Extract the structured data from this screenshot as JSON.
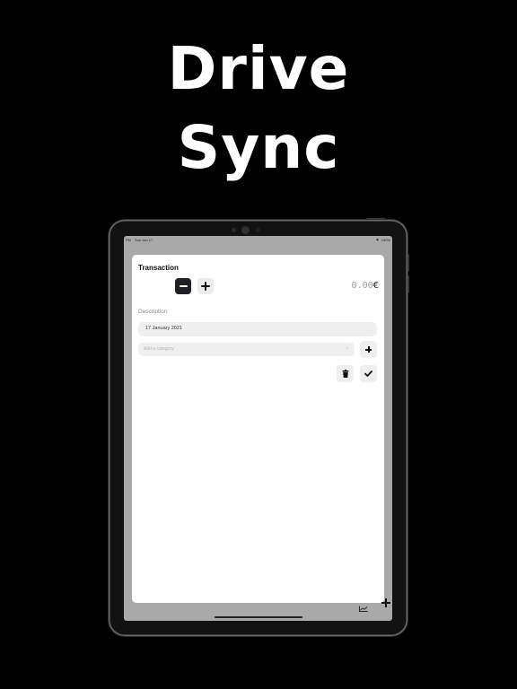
{
  "promo": {
    "line1": "Drive",
    "line2": "Sync"
  },
  "status_bar": {
    "time": "PM",
    "date": "Sun Jan 17",
    "battery": "100%"
  },
  "background": {
    "title": ""
  },
  "transaction_sheet": {
    "title": "Transaction",
    "amount_value": "0.00",
    "currency": "€",
    "description_label": "Description",
    "date_value": "17 January 2021",
    "category_placeholder": "Add a category",
    "category_chevron": "⌄"
  },
  "icons": {
    "sign_minus": "minus-icon",
    "sign_plus": "plus-icon",
    "add_category": "plus-icon",
    "delete": "trash-icon",
    "confirm": "check-icon",
    "chart": "chart-icon",
    "add": "plus-icon"
  },
  "colors": {
    "selected_sign_bg": "#1f1f25",
    "field_bg": "#efefef",
    "sheet_bg": "#ffffff",
    "screen_dim": "#a9a9a9"
  }
}
